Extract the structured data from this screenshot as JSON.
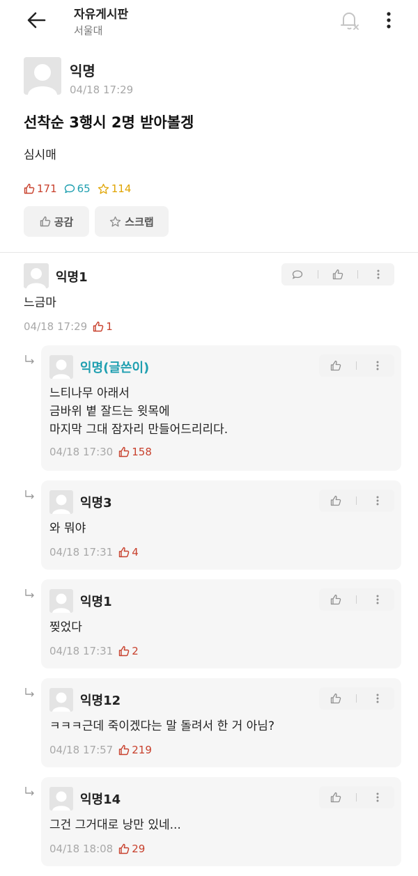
{
  "header": {
    "board_title": "자유게시판",
    "school": "서울대"
  },
  "post": {
    "author": "익명",
    "time": "04/18 17:29",
    "title": "선착순 3행시 2명 받아볼겡",
    "body": "심시매",
    "stats": {
      "likes": "171",
      "comments": "65",
      "scraps": "114"
    },
    "buttons": {
      "empathy": "공감",
      "scrap": "스크랩"
    }
  },
  "comment": {
    "author": "익명1",
    "text": "느금마",
    "time": "04/18 17:29",
    "likes": "1"
  },
  "replies": [
    {
      "author": "익명(글쓴이)",
      "text": "느티나무 아래서\n금바위 볕 잘드는 윗목에\n마지막 그대 잠자리 만들어드리리다.",
      "time": "04/18 17:30",
      "likes": "158"
    },
    {
      "author": "익명3",
      "text": "와 뭐야",
      "time": "04/18 17:31",
      "likes": "4"
    },
    {
      "author": "익명1",
      "text": "찢었다",
      "time": "04/18 17:31",
      "likes": "2"
    },
    {
      "author": "익명12",
      "text": "ㅋㅋㅋ근데 죽이겠다는 말 돌려서 한 거 아님?",
      "time": "04/18 17:57",
      "likes": "219"
    },
    {
      "author": "익명14",
      "text": "그건 그거대로 낭만 있네...",
      "time": "04/18 18:08",
      "likes": "29"
    }
  ],
  "colors": {
    "like": "#c8402c",
    "comment": "#1f9fb0",
    "scrap": "#e0a400",
    "op_author": "#1f9fb0"
  },
  "icons": [
    "back-arrow-icon",
    "bell-off-icon",
    "more-vertical-icon",
    "thumbs-up-icon",
    "comment-bubble-icon",
    "star-icon",
    "reply-arrow-icon",
    "avatar-icon"
  ]
}
